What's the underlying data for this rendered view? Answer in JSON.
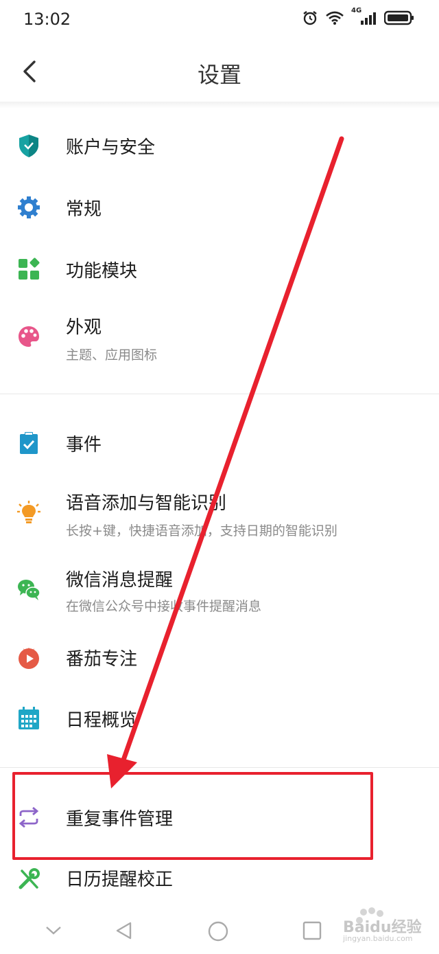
{
  "status_bar": {
    "time": "13:02",
    "network": "4G"
  },
  "header": {
    "title": "设置"
  },
  "items": [
    {
      "label": "账户与安全",
      "icon": "shield-icon"
    },
    {
      "label": "常规",
      "icon": "gear-icon"
    },
    {
      "label": "功能模块",
      "icon": "modules-icon"
    },
    {
      "label": "外观",
      "sub": "主题、应用图标",
      "icon": "palette-icon"
    },
    {
      "label": "事件",
      "icon": "clipboard-check-icon"
    },
    {
      "label": "语音添加与智能识别",
      "sub": "长按+键，快捷语音添加，支持日期的智能识别",
      "icon": "lightbulb-icon"
    },
    {
      "label": "微信消息提醒",
      "sub": "在微信公众号中接收事件提醒消息",
      "icon": "wechat-icon"
    },
    {
      "label": "番茄专注",
      "icon": "tomato-timer-icon"
    },
    {
      "label": "日程概览",
      "icon": "calendar-icon"
    },
    {
      "label": "重复事件管理",
      "icon": "repeat-icon"
    },
    {
      "label": "日历提醒校正",
      "icon": "wrench-icon"
    }
  ],
  "colors": {
    "teal": "#17a2a2",
    "blue": "#2f7fcf",
    "green": "#3cb553",
    "pink": "#e8568a",
    "orange": "#f39a25",
    "red": "#e55a46",
    "purple": "#8d65c9",
    "annotation": "#e8212e"
  },
  "watermark": {
    "text": "Baidu经验",
    "sub": "jingyan.baidu.com"
  }
}
